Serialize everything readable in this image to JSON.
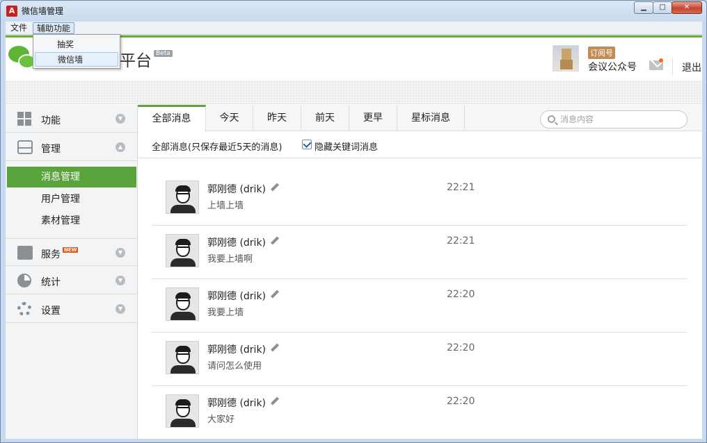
{
  "window": {
    "title": "微信墙管理",
    "controls": {
      "minimize": "▁",
      "maximize": "□",
      "close": "✕"
    }
  },
  "menubar": {
    "items": [
      "文件",
      "辅助功能"
    ]
  },
  "dropdown": {
    "items": [
      "抽奖",
      "微信墙"
    ]
  },
  "header": {
    "brand": "平台",
    "beta": "Beta",
    "account_type": "订阅号",
    "account_name": "会议公众号",
    "logout": "退出"
  },
  "sidebar": {
    "sections": [
      {
        "label": "功能",
        "icon": "grid-icon",
        "state": "collapsed"
      },
      {
        "label": "管理",
        "icon": "inbox-icon",
        "state": "expanded"
      },
      {
        "label": "服务",
        "icon": "printer-icon",
        "badge": "NEW",
        "state": "collapsed"
      },
      {
        "label": "统计",
        "icon": "pie-chart-icon",
        "state": "collapsed"
      },
      {
        "label": "设置",
        "icon": "gear-icon",
        "state": "collapsed"
      }
    ],
    "sub_items": [
      "消息管理",
      "用户管理",
      "素材管理"
    ],
    "active_sub": "消息管理"
  },
  "tabs": [
    "全部消息",
    "今天",
    "昨天",
    "前天",
    "更早",
    "星标消息"
  ],
  "search": {
    "placeholder": "消息内容"
  },
  "filter": {
    "label": "全部消息(只保存最近5天的消息)",
    "checkbox_label": "隐藏关键词消息",
    "checked": true
  },
  "messages": [
    {
      "name": "郭刚德 (drik)",
      "text": "上墙上墙",
      "time": "22:21"
    },
    {
      "name": "郭刚德 (drik)",
      "text": "我要上墙啊",
      "time": "22:21"
    },
    {
      "name": "郭刚德 (drik)",
      "text": "我要上墙",
      "time": "22:20"
    },
    {
      "name": "郭刚德 (drik)",
      "text": "请问怎么使用",
      "time": "22:20"
    },
    {
      "name": "郭刚德 (drik)",
      "text": "大家好",
      "time": "22:20"
    }
  ],
  "colors": {
    "accent_green": "#5aa43d",
    "title_bar": "#c6d9ee",
    "badge_orange": "#c28d55"
  }
}
